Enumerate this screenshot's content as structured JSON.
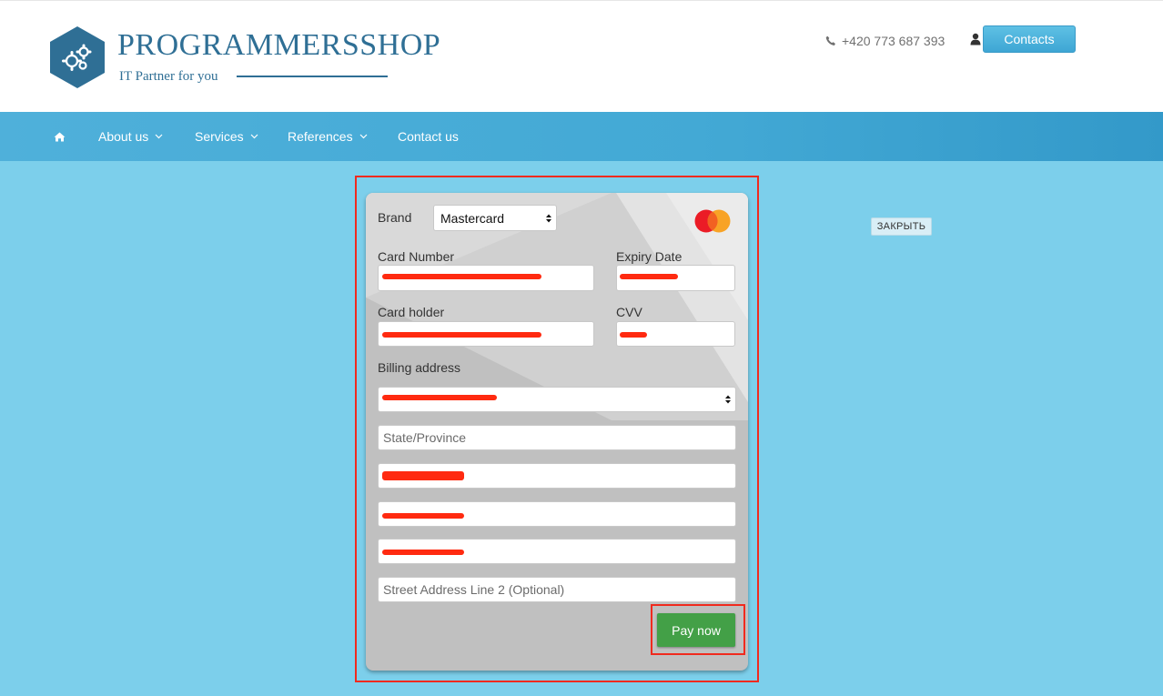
{
  "header": {
    "brand": "PROGRAMMERSSHOP",
    "tagline": "IT Partner for you",
    "phone": "+420 773 687 393",
    "contacts_label": "Contacts"
  },
  "nav": {
    "items": [
      {
        "label": "About us",
        "has_dropdown": true
      },
      {
        "label": "Services",
        "has_dropdown": true
      },
      {
        "label": "References",
        "has_dropdown": true
      },
      {
        "label": "Contact us",
        "has_dropdown": false
      }
    ]
  },
  "payment_form": {
    "brand_label": "Brand",
    "brand_value": "Mastercard",
    "card_number_label": "Card Number",
    "expiry_label": "Expiry Date",
    "card_holder_label": "Card holder",
    "cvv_label": "CVV",
    "billing_label": "Billing address",
    "state_placeholder": "State/Province",
    "street2_placeholder": "Street Address Line 2 (Optional)",
    "pay_label": "Pay now"
  },
  "close_label": "ЗАКРЫТЬ",
  "colors": {
    "brand_blue": "#2f6f95",
    "nav_blue": "#43a9d5",
    "page_bg": "#7ccfeb",
    "pay_green": "#43a047",
    "highlight_red": "#f02a1e"
  }
}
